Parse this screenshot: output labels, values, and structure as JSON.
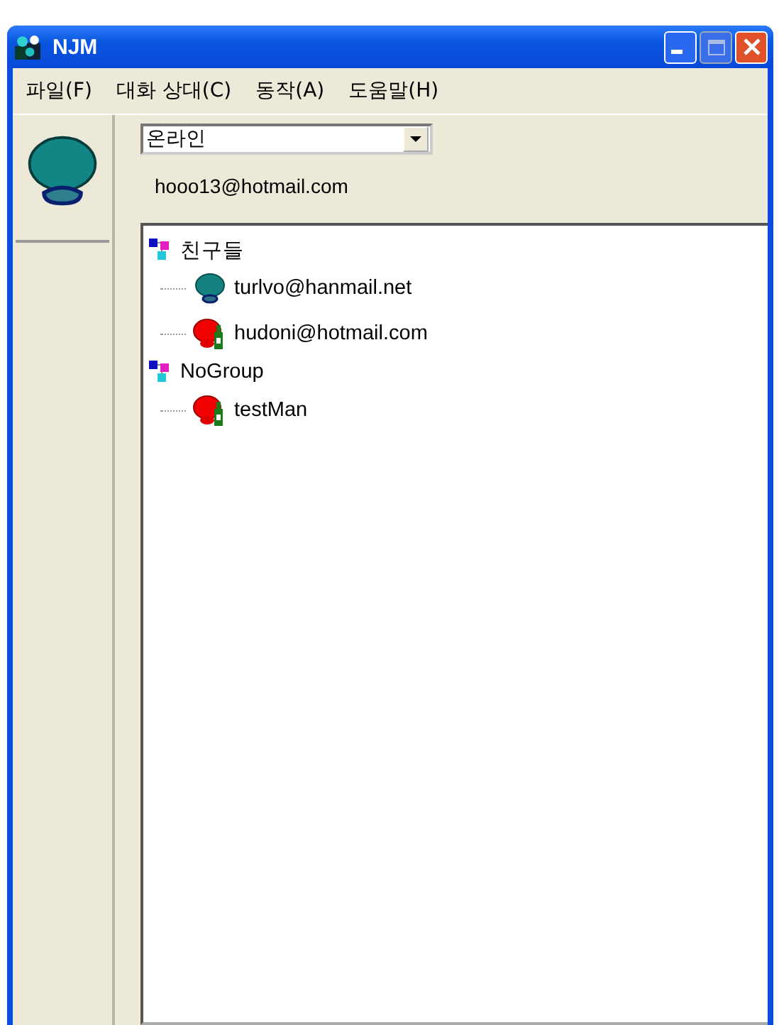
{
  "window": {
    "title": "NJM"
  },
  "menu": [
    "파일(F)",
    "대화 상대(C)",
    "동작(A)",
    "도움말(H)"
  ],
  "status": {
    "value": "온라인"
  },
  "account": "hooo13@hotmail.com",
  "groups": [
    {
      "name": "친구들",
      "children": [
        {
          "name": "turlvo@hanmail.net",
          "kind": "online"
        },
        {
          "name": "hudoni@hotmail.com",
          "kind": "away"
        }
      ]
    },
    {
      "name": "NoGroup",
      "children": [
        {
          "name": "testMan",
          "kind": "away"
        }
      ]
    }
  ]
}
